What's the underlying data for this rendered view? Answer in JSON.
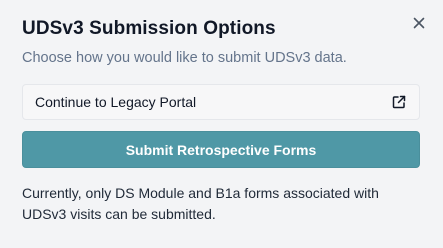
{
  "dialog": {
    "title": "UDSv3 Submission Options",
    "subtitle": "Choose how you would like to submit UDSv3 data.",
    "close_icon": "close-icon"
  },
  "actions": {
    "legacy_label": "Continue to Legacy Portal",
    "legacy_icon": "external-link-icon",
    "submit_label": "Submit Retrospective Forms"
  },
  "note": {
    "line1": "Currently, only DS Module and B1a forms associated with",
    "line2": "UDSv3 visits can be submitted."
  },
  "colors": {
    "background": "#f3f4f6",
    "primary_button": "#4f98a6",
    "title_text": "#111827",
    "subtitle_text": "#64748b"
  }
}
